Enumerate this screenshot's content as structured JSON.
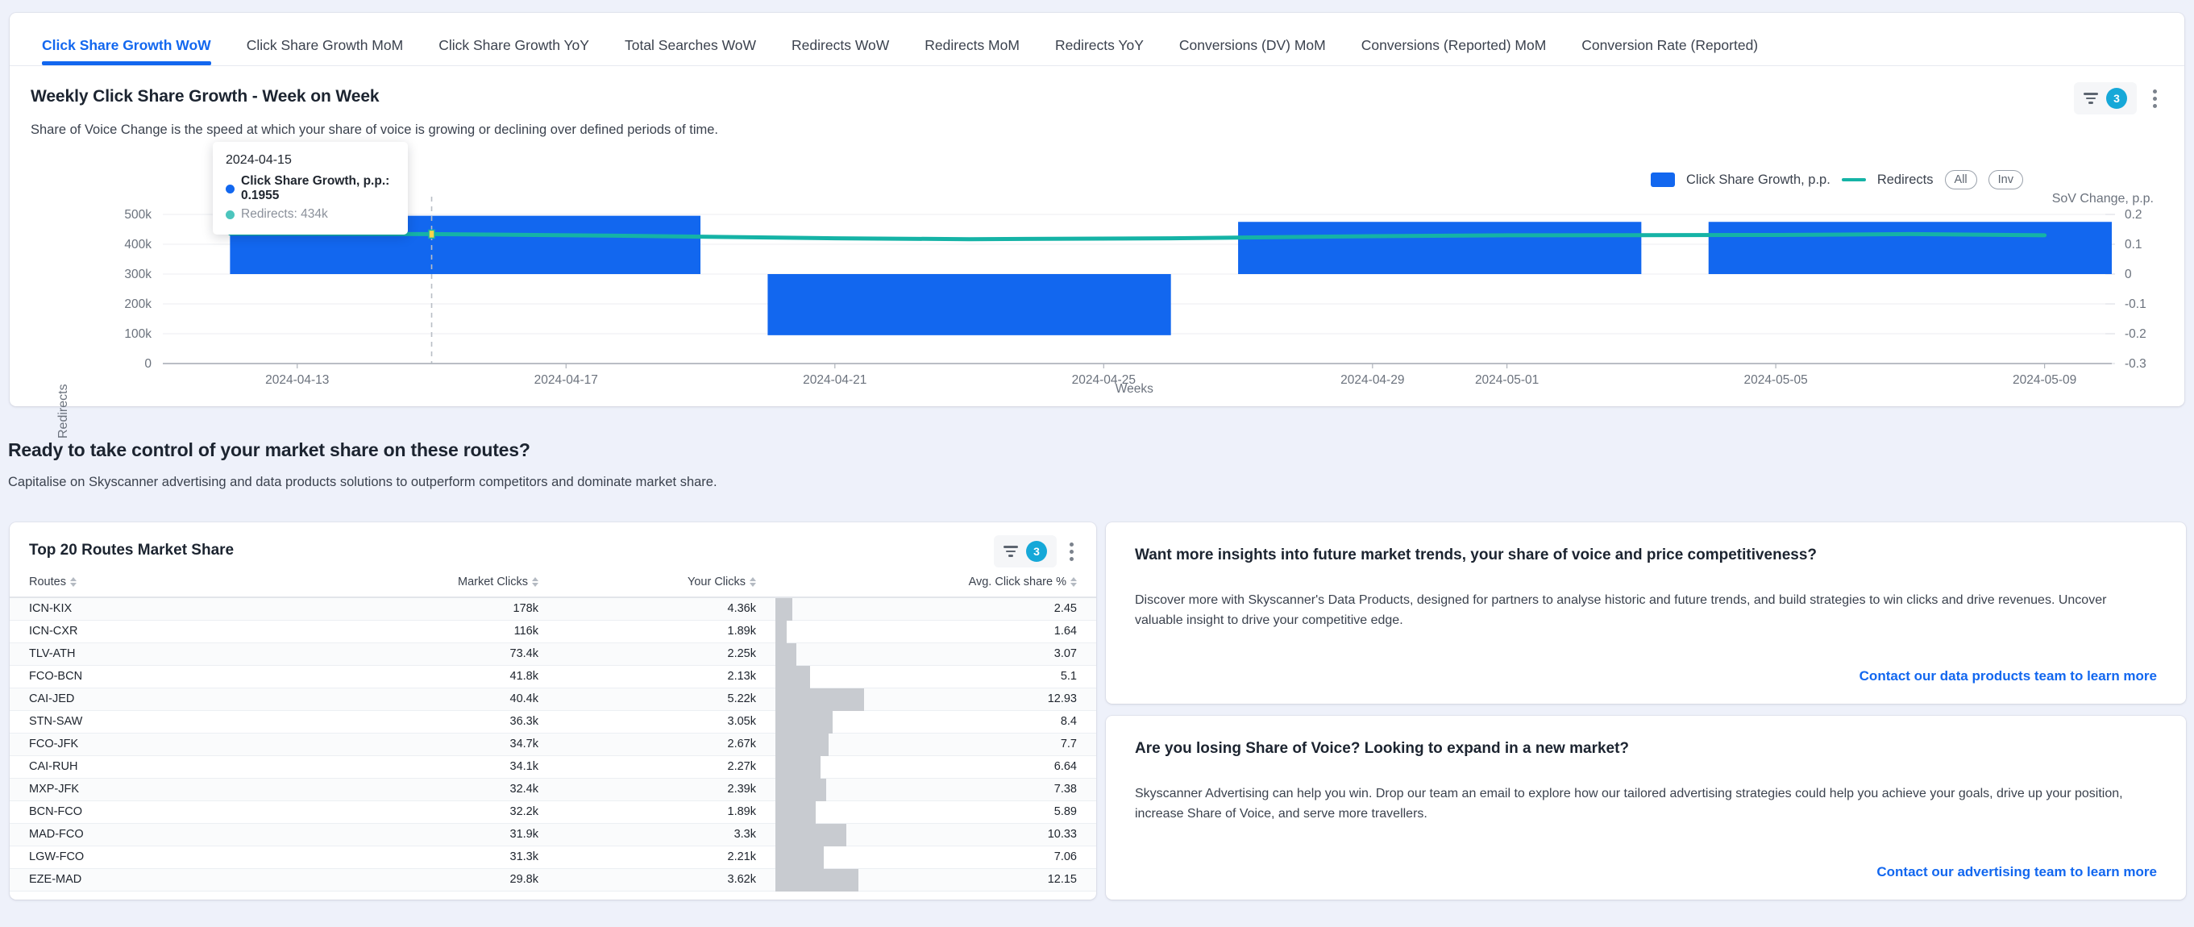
{
  "tabs": [
    {
      "label": "Click Share Growth WoW",
      "active": true
    },
    {
      "label": "Click Share Growth MoM",
      "active": false
    },
    {
      "label": "Click Share Growth YoY",
      "active": false
    },
    {
      "label": "Total Searches WoW",
      "active": false
    },
    {
      "label": "Redirects WoW",
      "active": false
    },
    {
      "label": "Redirects MoM",
      "active": false
    },
    {
      "label": "Redirects YoY",
      "active": false
    },
    {
      "label": "Conversions (DV) MoM",
      "active": false
    },
    {
      "label": "Conversions (Reported) MoM",
      "active": false
    },
    {
      "label": "Conversion Rate (Reported)",
      "active": false
    }
  ],
  "chart_card": {
    "title": "Weekly Click Share Growth - Week on Week",
    "subtitle": "Share of Voice Change is the speed at which your share of voice is growing or declining over defined periods of time.",
    "filter_badge": "3",
    "legend": {
      "bar_label": "Click Share Growth, p.p.",
      "line_label": "Redirects",
      "all_label": "All",
      "inv_label": "Inv"
    },
    "tooltip": {
      "date": "2024-04-15",
      "primary": "Click Share Growth, p.p.: 0.1955",
      "secondary": "Redirects: 434k",
      "primary_color": "#1267ef",
      "secondary_color": "#4cc5bd"
    }
  },
  "chart_data": {
    "type": "bar",
    "title": "Weekly Click Share Growth - Week on Week",
    "xlabel": "Weeks",
    "ylabel": "Redirects",
    "y2label": "SoV Change, p.p.",
    "grid": true,
    "legend_position": "top-right",
    "x_tick_labels": [
      "2024-04-13",
      "2024-04-17",
      "2024-04-21",
      "2024-04-25",
      "2024-04-29",
      "2024-05-01",
      "2024-05-05",
      "2024-05-09"
    ],
    "y_tick_labels": [
      "0",
      "100k",
      "200k",
      "300k",
      "400k",
      "500k"
    ],
    "y_values": [
      0,
      100000,
      200000,
      300000,
      400000,
      500000
    ],
    "ylim": [
      0,
      520000
    ],
    "y2_tick_labels": [
      "0.2",
      "0.1",
      "0",
      "-0.1",
      "-0.2",
      "-0.3"
    ],
    "y2_values": [
      0.2,
      0.1,
      0,
      -0.1,
      -0.2,
      -0.3
    ],
    "y2lim": [
      -0.3,
      0.2
    ],
    "bar_color": "#1267ef",
    "line_color": "#15b3a6",
    "series": [
      {
        "name": "Click Share Growth, p.p.",
        "type": "bar",
        "bars": [
          {
            "x_start": "2024-04-12",
            "x_end": "2024-04-19",
            "top": 0.1955,
            "bottom": 0.0
          },
          {
            "x_start": "2024-04-20",
            "x_end": "2024-04-26",
            "top": 0.0,
            "bottom": -0.205
          },
          {
            "x_start": "2024-04-27",
            "x_end": "2024-05-03",
            "top": 0.175,
            "bottom": 0.0
          },
          {
            "x_start": "2024-05-04",
            "x_end": "2024-05-10",
            "top": 0.175,
            "bottom": 0.0
          }
        ]
      },
      {
        "name": "Redirects",
        "type": "line",
        "points": [
          {
            "x": "2024-04-12",
            "y": 436000
          },
          {
            "x": "2024-04-15",
            "y": 434000
          },
          {
            "x": "2024-04-18",
            "y": 428000
          },
          {
            "x": "2024-04-21",
            "y": 420000
          },
          {
            "x": "2024-04-23",
            "y": 417000
          },
          {
            "x": "2024-04-26",
            "y": 420000
          },
          {
            "x": "2024-04-29",
            "y": 427000
          },
          {
            "x": "2024-05-01",
            "y": 430000
          },
          {
            "x": "2024-05-05",
            "y": 431000
          },
          {
            "x": "2024-05-07",
            "y": 434000
          },
          {
            "x": "2024-05-09",
            "y": 430000
          }
        ]
      }
    ],
    "highlight_point": {
      "x": "2024-04-15",
      "y": 434000,
      "growth": 0.1955
    }
  },
  "cta": {
    "title": "Ready to take control of your market share on these routes?",
    "subtitle": "Capitalise on Skyscanner advertising and data products solutions to outperform competitors and dominate market share."
  },
  "table": {
    "title": "Top 20 Routes Market Share",
    "filter_badge": "3",
    "columns": [
      "Routes",
      "Market Clicks",
      "Your Clicks",
      "Avg. Click share %"
    ],
    "max_share": 12.93,
    "rows": [
      {
        "route": "ICN-KIX",
        "market_clicks": "178k",
        "your_clicks": "4.36k",
        "avg_click_share": "2.45",
        "share_value": 2.45
      },
      {
        "route": "ICN-CXR",
        "market_clicks": "116k",
        "your_clicks": "1.89k",
        "avg_click_share": "1.64",
        "share_value": 1.64
      },
      {
        "route": "TLV-ATH",
        "market_clicks": "73.4k",
        "your_clicks": "2.25k",
        "avg_click_share": "3.07",
        "share_value": 3.07
      },
      {
        "route": "FCO-BCN",
        "market_clicks": "41.8k",
        "your_clicks": "2.13k",
        "avg_click_share": "5.1",
        "share_value": 5.1
      },
      {
        "route": "CAI-JED",
        "market_clicks": "40.4k",
        "your_clicks": "5.22k",
        "avg_click_share": "12.93",
        "share_value": 12.93
      },
      {
        "route": "STN-SAW",
        "market_clicks": "36.3k",
        "your_clicks": "3.05k",
        "avg_click_share": "8.4",
        "share_value": 8.4
      },
      {
        "route": "FCO-JFK",
        "market_clicks": "34.7k",
        "your_clicks": "2.67k",
        "avg_click_share": "7.7",
        "share_value": 7.7
      },
      {
        "route": "CAI-RUH",
        "market_clicks": "34.1k",
        "your_clicks": "2.27k",
        "avg_click_share": "6.64",
        "share_value": 6.64
      },
      {
        "route": "MXP-JFK",
        "market_clicks": "32.4k",
        "your_clicks": "2.39k",
        "avg_click_share": "7.38",
        "share_value": 7.38
      },
      {
        "route": "BCN-FCO",
        "market_clicks": "32.2k",
        "your_clicks": "1.89k",
        "avg_click_share": "5.89",
        "share_value": 5.89
      },
      {
        "route": "MAD-FCO",
        "market_clicks": "31.9k",
        "your_clicks": "3.3k",
        "avg_click_share": "10.33",
        "share_value": 10.33
      },
      {
        "route": "LGW-FCO",
        "market_clicks": "31.3k",
        "your_clicks": "2.21k",
        "avg_click_share": "7.06",
        "share_value": 7.06
      },
      {
        "route": "EZE-MAD",
        "market_clicks": "29.8k",
        "your_clicks": "3.62k",
        "avg_click_share": "12.15",
        "share_value": 12.15
      }
    ]
  },
  "info_cards": [
    {
      "title": "Want more insights into future market trends, your share of voice and price competitiveness?",
      "body": "Discover more with Skyscanner's Data Products, designed for partners to analyse historic and future trends, and build strategies to win clicks and drive revenues. Uncover valuable insight to drive your competitive edge.",
      "link": "Contact our data products team to learn more"
    },
    {
      "title": "Are you losing Share of Voice? Looking to expand in a new market?",
      "body": "Skyscanner Advertising can help you win. Drop our team an email to explore how our tailored advertising strategies could help you achieve your goals, drive up your position, increase Share of Voice, and serve more travellers.",
      "link": "Contact our advertising team to learn more"
    }
  ]
}
